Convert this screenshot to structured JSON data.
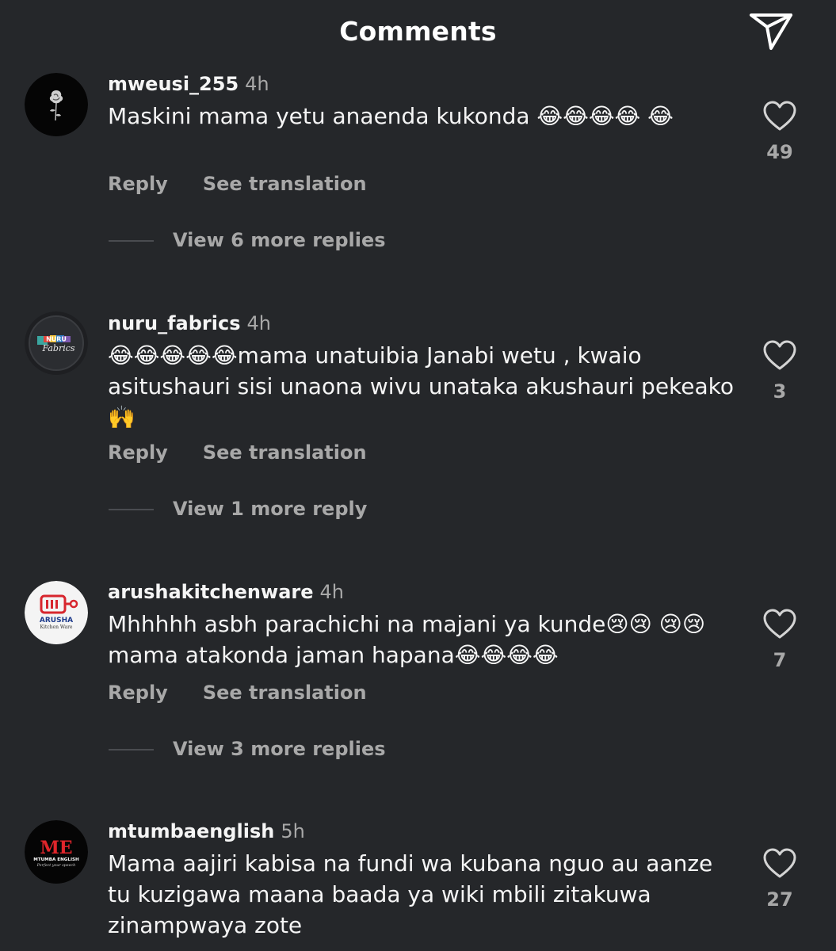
{
  "header": {
    "title": "Comments"
  },
  "comments": [
    {
      "username": "mweusi_255",
      "time": "4h",
      "text": "Maskini mama yetu anaenda kukonda 😂😂😂😂 😂",
      "likes": "49",
      "reply_label": "Reply",
      "translate_label": "See translation",
      "view_more": "View 6 more replies"
    },
    {
      "username": "nuru_fabrics",
      "time": "4h",
      "text": "😂😂😂😂😂mama unatuibia Janabi wetu ,  kwaio asitushauri sisi unaona wivu unataka akushauri pekeako🙌",
      "likes": "3",
      "reply_label": "Reply",
      "translate_label": "See translation",
      "view_more": "View 1 more reply",
      "avatar_text": "NURU Fabrics"
    },
    {
      "username": "arushakitchenware",
      "time": "4h",
      "text": "Mhhhhh asbh parachichi na majani ya kunde😢😢 😢😢 mama atakonda jaman hapana😂😂😂😂",
      "likes": "7",
      "reply_label": "Reply",
      "translate_label": "See translation",
      "view_more": "View 3 more replies",
      "avatar_text": "ARUSHA",
      "avatar_subtext": "Kitchen Ware"
    },
    {
      "username": "mtumbaenglish",
      "time": "5h",
      "text": "Mama aajiri kabisa na fundi wa kubana nguo au aanze tu kuzigawa maana baada ya wiki mbili zitakuwa zinampwaya zote",
      "likes": "27",
      "avatar_text": "MTUMBA ENGLISH",
      "avatar_subtext": "Perfect your speech"
    }
  ],
  "colors": {
    "background": "#25272a",
    "text_primary": "#f5f5f5",
    "text_secondary": "#a8a8a8"
  },
  "icons": {
    "share": "paper-plane-icon",
    "like": "heart-outline-icon"
  }
}
